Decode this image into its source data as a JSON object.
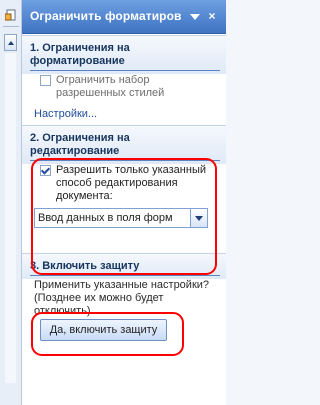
{
  "pane": {
    "title": "Ограничить форматиров"
  },
  "sections": {
    "formatting": {
      "title": "1. Ограничения на форматирование",
      "checkbox_label": "Ограничить набор разрешенных стилей",
      "checked": false,
      "settings_link": "Настройки..."
    },
    "editing": {
      "title": "2. Ограничения на редактирование",
      "checkbox_label": "Разрешить только указанный способ редактирования документа:",
      "checked": true,
      "select_value": "Ввод данных в поля форм"
    },
    "protection": {
      "title": "3. Включить защиту",
      "description": "Применить указанные настройки? (Позднее их можно будет отключить)",
      "button_label": "Да, включить защиту"
    }
  },
  "colors": {
    "header": "#3f73c2",
    "accent": "#1f4e9d",
    "callout": "#ff0000"
  }
}
